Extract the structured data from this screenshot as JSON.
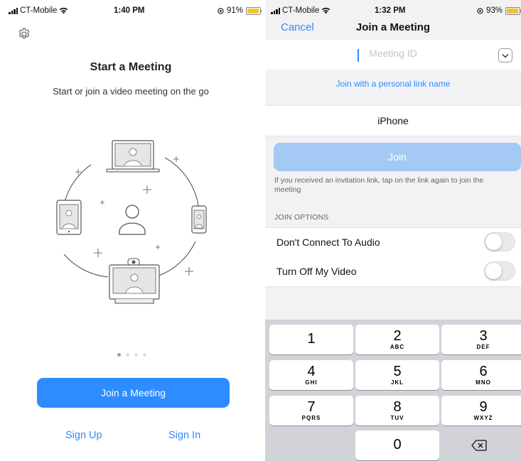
{
  "left": {
    "status": {
      "carrier": "CT-Mobile",
      "time": "1:40 PM",
      "battery": "91%",
      "battery_level": 0.91
    },
    "title": "Start a Meeting",
    "subtitle": "Start or join a video meeting on the go",
    "pager": {
      "count": 4,
      "active": 0
    },
    "join_button": "Join a Meeting",
    "sign_up": "Sign Up",
    "sign_in": "Sign In"
  },
  "right": {
    "status": {
      "carrier": "CT-Mobile",
      "time": "1:32 PM",
      "battery": "93%",
      "battery_level": 0.93
    },
    "nav": {
      "cancel": "Cancel",
      "title": "Join a Meeting"
    },
    "meeting_id": {
      "value": "",
      "placeholder": "Meeting ID"
    },
    "personal_link": "Join with a personal link name",
    "name": "iPhone",
    "join": "Join",
    "hint": "If you received an invitation link, tap on the link again to join the meeting",
    "options_header": "JOIN OPTIONS",
    "options": [
      {
        "label": "Don't Connect To Audio",
        "on": false
      },
      {
        "label": "Turn Off My Video",
        "on": false
      }
    ],
    "keypad": [
      {
        "num": "1",
        "letters": ""
      },
      {
        "num": "2",
        "letters": "ABC"
      },
      {
        "num": "3",
        "letters": "DEF"
      },
      {
        "num": "4",
        "letters": "GHI"
      },
      {
        "num": "5",
        "letters": "JKL"
      },
      {
        "num": "6",
        "letters": "MNO"
      },
      {
        "num": "7",
        "letters": "PQRS"
      },
      {
        "num": "8",
        "letters": "TUV"
      },
      {
        "num": "9",
        "letters": "WXYZ"
      },
      {
        "num": "0",
        "letters": ""
      }
    ]
  },
  "colors": {
    "accent": "#2d8cff",
    "join_disabled": "#a5c9f5",
    "battery": "#f4c430"
  },
  "icons": [
    "gear-icon",
    "wifi-icon",
    "signal-icon",
    "battery-icon",
    "chevron-down-icon",
    "delete-key-icon",
    "laptop-icon",
    "tablet-icon",
    "phone-icon",
    "person-icon",
    "camera-device-icon"
  ]
}
